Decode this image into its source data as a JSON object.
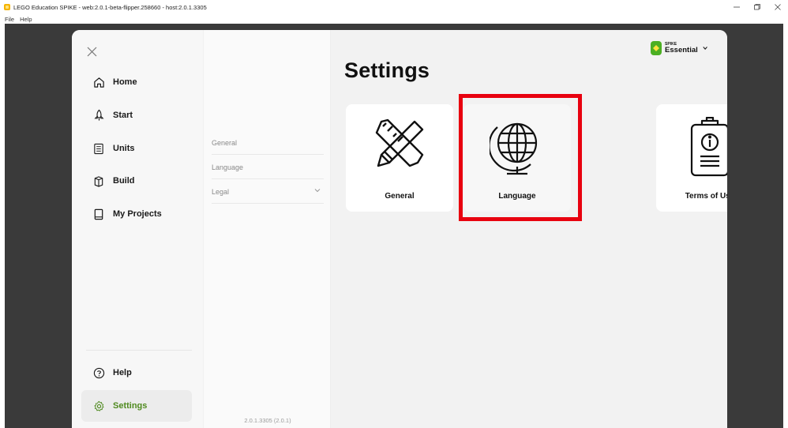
{
  "window": {
    "title": "LEGO Education SPIKE - web:2.0.1-beta-flipper.258660 - host:2.0.1.3305",
    "menu": [
      "File",
      "Help"
    ]
  },
  "left_nav": {
    "items": [
      {
        "label": "Home",
        "icon": "home-icon"
      },
      {
        "label": "Start",
        "icon": "rocket-icon"
      },
      {
        "label": "Units",
        "icon": "units-icon"
      },
      {
        "label": "Build",
        "icon": "build-brick-icon"
      },
      {
        "label": "My Projects",
        "icon": "book-icon"
      }
    ],
    "bottom": [
      {
        "label": "Help",
        "icon": "help-icon"
      },
      {
        "label": "Settings",
        "icon": "gear-icon",
        "active": true
      }
    ]
  },
  "sub_nav": {
    "items": [
      "General",
      "Language",
      "Legal"
    ],
    "version": "2.0.1.3305 (2.0.1)"
  },
  "content": {
    "title": "Settings",
    "hub": {
      "small": "SPIKE",
      "big": "Essential"
    },
    "cards": [
      {
        "label": "General",
        "icon": "ruler-pencil-icon"
      },
      {
        "label": "Language",
        "icon": "globe-icon"
      },
      {
        "label": "Terms of Use",
        "icon": "clipboard-info-icon"
      }
    ]
  },
  "colors": {
    "accent_green": "#4f8a1f",
    "hub_green": "#4caf23",
    "highlight_red": "#e8000f",
    "backdrop": "#3a3a3a"
  }
}
